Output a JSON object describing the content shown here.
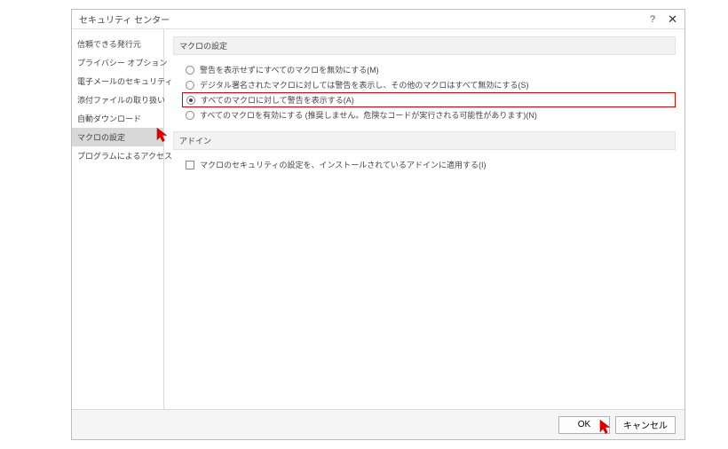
{
  "title": "セキュリティ センター",
  "sidebar": {
    "items": [
      "信頼できる発行元",
      "プライバシー オプション",
      "電子メールのセキュリティ",
      "添付ファイルの取り扱い",
      "自動ダウンロード",
      "マクロの設定",
      "プログラムによるアクセス"
    ],
    "selected_index": 5
  },
  "section_macro_title": "マクロの設定",
  "options": [
    "警告を表示せずにすべてのマクロを無効にする(M)",
    "デジタル署名されたマクロに対しては警告を表示し、その他のマクロはすべて無効にする(S)",
    "すべてのマクロに対して警告を表示する(A)",
    "すべてのマクロを有効にする (推奨しません。危険なコードが実行される可能性があります)(N)"
  ],
  "options_selected_index": 2,
  "section_addin_title": "アドイン",
  "addin_checkbox_label": "マクロのセキュリティの設定を、インストールされているアドインに適用する(I)",
  "buttons": {
    "ok": "OK",
    "cancel": "キャンセル"
  }
}
